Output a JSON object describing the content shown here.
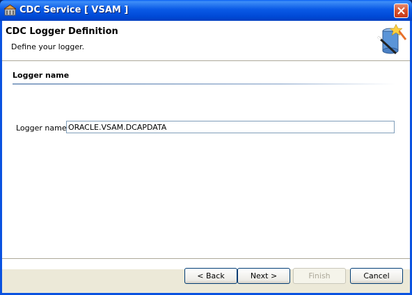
{
  "window": {
    "title": "CDC Service [ VSAM ]"
  },
  "header": {
    "title": "CDC Logger Definition",
    "subtitle": "Define your logger."
  },
  "section": {
    "title": "Logger name",
    "field_label": "Logger name:",
    "field_value": "ORACLE.VSAM.DCAPDATA"
  },
  "buttons": {
    "back": "< Back",
    "next": "Next >",
    "finish": "Finish",
    "cancel": "Cancel"
  },
  "icons": {
    "app": "database-app-icon",
    "close": "close-icon",
    "logo": "database-wand-logo"
  },
  "colors": {
    "titlebar": "#0a5ae6",
    "close": "#d6502a",
    "background": "#ece9d8"
  }
}
